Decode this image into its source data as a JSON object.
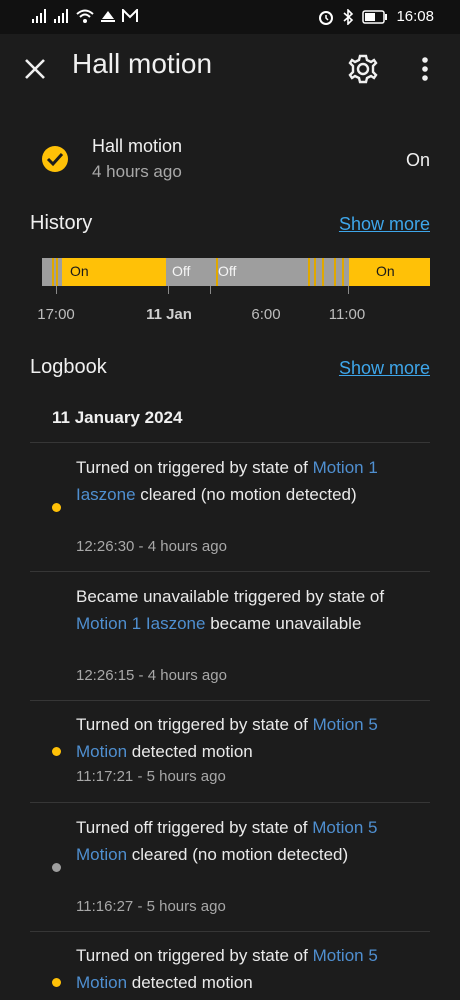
{
  "status_bar": {
    "time": "16:08",
    "icons": [
      "signal-icon",
      "signal-icon",
      "wifi-icon",
      "cast-icon",
      "mail-icon",
      "alarm-icon",
      "bluetooth-icon",
      "battery-icon"
    ]
  },
  "app_bar": {
    "title": "Hall motion",
    "icons": [
      "close-icon",
      "gear-icon",
      "more-vertical-icon"
    ]
  },
  "entity": {
    "name": "Hall motion",
    "last_changed": "4 hours ago",
    "state": "On",
    "icon": "check-circle-icon"
  },
  "history": {
    "title": "History",
    "show_more": "Show more",
    "segments": [
      {
        "label": "On"
      },
      {
        "label": "Off"
      },
      {
        "label": "Off"
      },
      {
        "label": "On"
      }
    ],
    "axis_labels": [
      "17:00",
      "11 Jan",
      "6:00",
      "11:00"
    ]
  },
  "logbook": {
    "title": "Logbook",
    "show_more": "Show more",
    "date": "11 January 2024",
    "entries": [
      {
        "pre": "Turned on triggered by state of ",
        "entity": "Motion 1 Iaszone",
        "post": " cleared (no motion detected)",
        "time": "12:26:30 - 4 hours ago",
        "dot": "on"
      },
      {
        "pre": "Became unavailable triggered by state of ",
        "entity": "Motion 1 Iaszone",
        "post": " became unavailable",
        "time": "12:26:15 - 4 hours ago",
        "dot": "none"
      },
      {
        "pre": "Turned on triggered by state of ",
        "entity": "Motion 5 Motion",
        "post": " detected motion",
        "time": "11:17:21 - 5 hours ago",
        "dot": "on"
      },
      {
        "pre": "Turned off triggered by state of ",
        "entity": "Motion 5 Motion",
        "post": " cleared (no motion detected)",
        "time": "11:16:27 - 5 hours ago",
        "dot": "off"
      },
      {
        "pre": "Turned on triggered by state of ",
        "entity": "Motion 5 Motion",
        "post": " detected motion",
        "time": "",
        "dot": "on"
      }
    ]
  },
  "colors": {
    "background": "#1c1c1c",
    "on": "#ffc107",
    "off": "#9e9e9e",
    "link": "#3ea6ea"
  }
}
